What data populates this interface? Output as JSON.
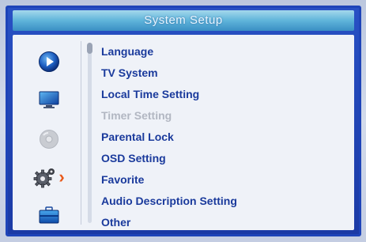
{
  "window": {
    "title": "System Setup"
  },
  "sidebar": {
    "icons": [
      {
        "name": "media-play-icon",
        "selected": false
      },
      {
        "name": "tv-screen-icon",
        "selected": false
      },
      {
        "name": "disc-icon",
        "selected": false,
        "disabled": true
      },
      {
        "name": "system-gear-icon",
        "selected": true
      },
      {
        "name": "toolbox-icon",
        "selected": false
      }
    ],
    "selected_marker": "›"
  },
  "menu": {
    "items": [
      {
        "label": "Language",
        "enabled": true
      },
      {
        "label": "TV System",
        "enabled": true
      },
      {
        "label": "Local Time Setting",
        "enabled": true
      },
      {
        "label": "Timer Setting",
        "enabled": false
      },
      {
        "label": "Parental Lock",
        "enabled": true
      },
      {
        "label": "OSD Setting",
        "enabled": true
      },
      {
        "label": "Favorite",
        "enabled": true
      },
      {
        "label": "Audio Description Setting",
        "enabled": true
      },
      {
        "label": "Other",
        "enabled": true
      }
    ]
  },
  "colors": {
    "frame": "#1e44b8",
    "title_bar": "#5fb4da",
    "menu_text": "#1a3a9c",
    "disabled_text": "#b2b7c2",
    "marker": "#e8591a"
  }
}
